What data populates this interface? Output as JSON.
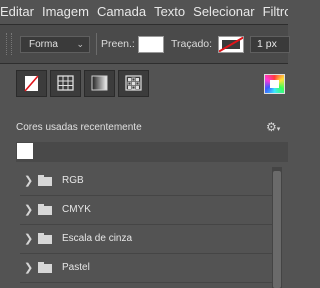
{
  "menubar": {
    "items": [
      "Editar",
      "Imagem",
      "Camada",
      "Texto",
      "Selecionar",
      "Filtro"
    ]
  },
  "options": {
    "mode_value": "Forma",
    "fill_label": "Preen.:",
    "fill_color": "#ffffff",
    "stroke_label": "Traçado:",
    "stroke_width": "1 px"
  },
  "panel": {
    "tool_icons": [
      "no-color-icon",
      "grid-icon",
      "gradient-icon",
      "pattern-icon"
    ],
    "recent_label": "Cores usadas recentemente",
    "recent_colors": [
      "#ffffff"
    ],
    "folders": [
      {
        "name": "RGB"
      },
      {
        "name": "CMYK"
      },
      {
        "name": "Escala de cinza"
      },
      {
        "name": "Pastel"
      }
    ]
  }
}
